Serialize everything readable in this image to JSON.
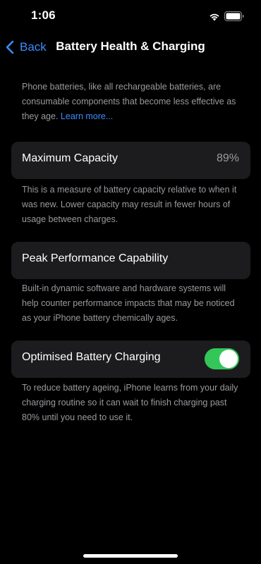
{
  "status_bar": {
    "time": "1:06",
    "wifi_icon": "wifi-icon",
    "battery_icon": "battery-full-icon"
  },
  "nav": {
    "back_label": "Back",
    "title": "Battery Health & Charging"
  },
  "intro": {
    "text": "Phone batteries, like all rechargeable batteries, are consumable components that become less effective as they age.",
    "link": "Learn more..."
  },
  "maximum_capacity": {
    "label": "Maximum Capacity",
    "value": "89%",
    "footer": "This is a measure of battery capacity relative to when it was new. Lower capacity may result in fewer hours of usage between charges."
  },
  "peak_performance": {
    "label": "Peak Performance Capability",
    "footer": "Built-in dynamic software and hardware systems will help counter performance impacts that may be noticed as your iPhone battery chemically ages."
  },
  "optimised_charging": {
    "label": "Optimised Battery Charging",
    "enabled": true,
    "footer": "To reduce battery ageing, iPhone learns from your daily charging routine so it can wait to finish charging past 80% until you need to use it."
  },
  "colors": {
    "accent": "#3a8dff",
    "toggle_on": "#33c759",
    "cell_bg": "#1c1c1e",
    "secondary_text": "#9a9aa0"
  }
}
